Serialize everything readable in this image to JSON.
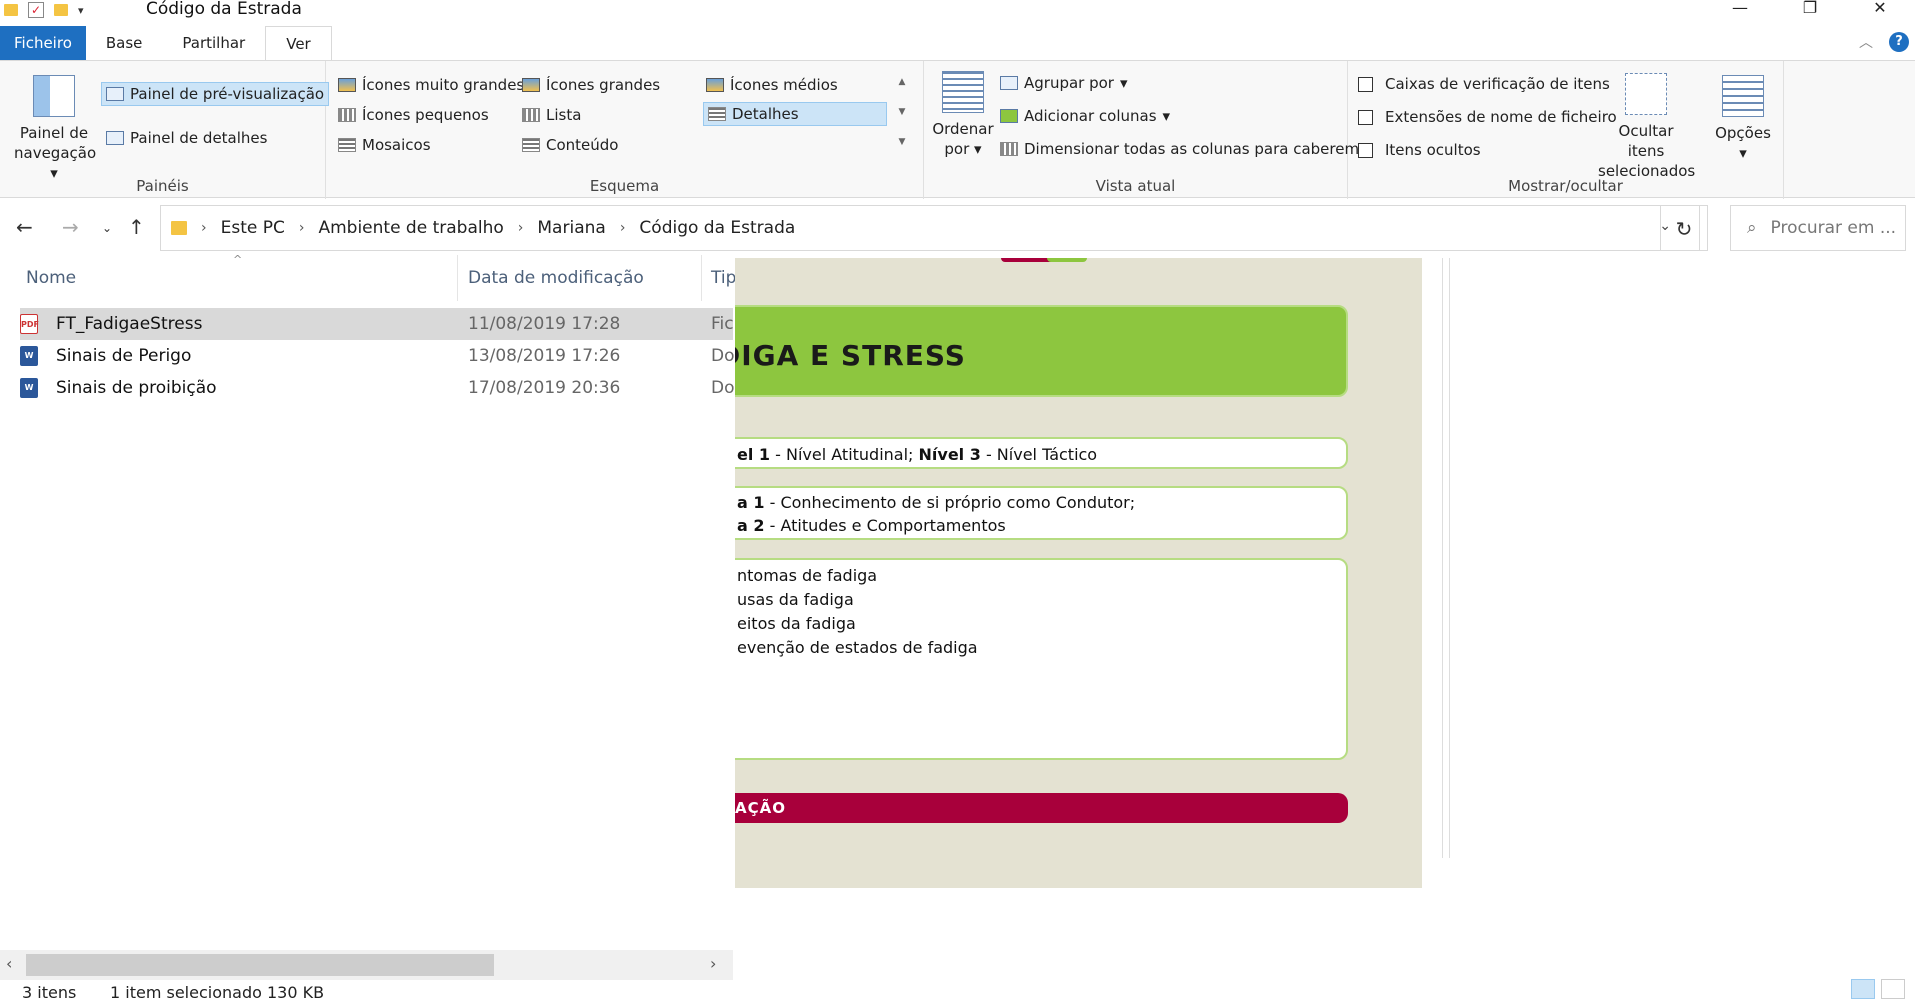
{
  "window": {
    "title": "Código da Estrada"
  },
  "tabs": [
    {
      "label": "Ficheiro"
    },
    {
      "label": "Base"
    },
    {
      "label": "Partilhar"
    },
    {
      "label": "Ver"
    }
  ],
  "ribbon": {
    "paineis": {
      "label": "Painéis",
      "nav_pane": "Painel de navegação",
      "preview_pane": "Painel de pré-visualização",
      "details_pane": "Painel de detalhes"
    },
    "esquema": {
      "label": "Esquema",
      "items": [
        "Ícones muito grandes",
        "Ícones grandes",
        "Ícones médios",
        "Ícones pequenos",
        "Lista",
        "Detalhes",
        "Mosaicos",
        "Conteúdo"
      ],
      "selected": "Detalhes"
    },
    "vista_atual": {
      "label": "Vista atual",
      "sort": "Ordenar por",
      "group_by": "Agrupar por",
      "add_columns": "Adicionar colunas",
      "fit_columns": "Dimensionar todas as colunas para caberem"
    },
    "mostrar_ocultar": {
      "label": "Mostrar/ocultar",
      "item_checkboxes": "Caixas de verificação de itens",
      "extensions": "Extensões de nome de ficheiro",
      "hidden_items": "Itens ocultos",
      "hide_selected": "Ocultar itens selecionados"
    },
    "options": "Opções"
  },
  "address": {
    "crumbs": [
      "Este PC",
      "Ambiente de trabalho",
      "Mariana",
      "Código da Estrada"
    ],
    "search_placeholder": "Procurar em ..."
  },
  "columns": {
    "name": "Nome",
    "date": "Data de modificação",
    "type": "Tip"
  },
  "files": [
    {
      "name": "FT_FadigaeStress",
      "date": "11/08/2019 17:28",
      "type": "Fic",
      "kind": "pdf"
    },
    {
      "name": "Sinais de Perigo",
      "date": "13/08/2019 17:26",
      "type": "Do",
      "kind": "doc"
    },
    {
      "name": "Sinais de proibição",
      "date": "17/08/2019 20:36",
      "type": "Do",
      "kind": "doc"
    }
  ],
  "preview": {
    "title": "DIGA E STRESS",
    "level_line": {
      "a": "el 1",
      "b": " - Nível Atitudinal; ",
      "c": "Nível 3",
      "d": " - Nível Táctico"
    },
    "area1": {
      "a": "a 1",
      "b": " - Conhecimento de si próprio como Condutor;"
    },
    "area2": {
      "a": "a 2",
      "b": " - Atitudes e Comportamentos"
    },
    "topics": [
      "ntomas de fadiga",
      "usas da fadiga",
      "eitos da fadiga",
      "evenção de estados de fadiga"
    ],
    "red_bar": "AÇÃO"
  },
  "status": {
    "count": "3 itens",
    "selected": "1 item selecionado 130 KB"
  }
}
